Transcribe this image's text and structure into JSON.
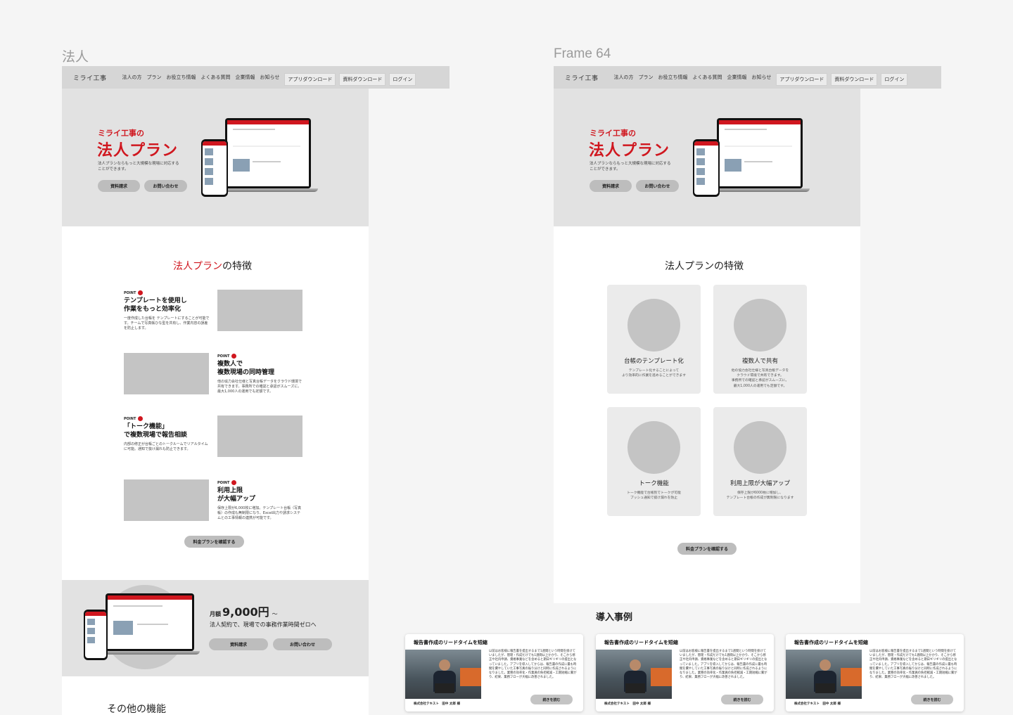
{
  "frames": [
    {
      "label": "法人"
    },
    {
      "label": "Frame 64"
    }
  ],
  "nav": {
    "brand": "ミライ工事",
    "items": [
      "法人の方",
      "プラン",
      "お役立ち情報",
      "よくある質問",
      "企業情報",
      "お知らせ"
    ],
    "buttons": [
      "アプリダウンロード",
      "資料ダウンロード",
      "ログイン"
    ]
  },
  "hero": {
    "subtitle": "ミライ工事の",
    "title": "法人プラン",
    "desc": "法人プランならもっと大規模な現場に対応することができます。",
    "btn_docs": "資料請求",
    "btn_contact": "お問い合わせ"
  },
  "features": {
    "title_red": "法人プラン",
    "title_rest": "の特徴",
    "title_full": "法人プランの特徴",
    "point_label": "POINT",
    "points": [
      {
        "title": "テンプレートを使用し\n作業をもっと効率化",
        "desc": "一度作成した台帳を テンプレートにすることが可能です。チームで写真帳ひな型を共有し、作業内容の誤差を防止します。"
      },
      {
        "title": "複数人で\n複数現場の同時管理",
        "desc": "他の協力会社仕様と写真台帳データをクラウド環境で共有できます。事務所での確認と承認がスムーズに。最大1,000人の運用でも定額です。"
      },
      {
        "title": "「トーク機能」\nで複数現場で報告相談",
        "desc": "内部の修正が台帳ごとのトークルームでリアルタイムに可能。通知で抜け漏れも防止できます。"
      },
      {
        "title": "利用上限\nが大幅アップ",
        "desc": "保存上限が6,000枚に増加。テンプレート台帳（写真帳）の作成も無制限になり、Excel出力や請求システムとの工事情報の連携が可能です。"
      }
    ],
    "cta": "料金プランを確認する"
  },
  "price": {
    "prefix": "月額",
    "amount": "9,000円",
    "suffix": "～",
    "desc": "法人契約で、現場での事務作業時間ゼロへ",
    "btn_docs": "資料請求",
    "btn_contact": "お問い合わせ"
  },
  "other": {
    "title": "その他の機能"
  },
  "cards": [
    {
      "title": "台帳のテンプレート化",
      "desc": "テンプレート化することによって\nより効率的に作業を進めることができます"
    },
    {
      "title": "複数人で共有",
      "desc": "他の協力会社仕様と写真台帳データを\nクラウド環境で共有できます。\n事務所での確認と承認がスムーズに。\n最大1,000人の運用でも定額です。"
    },
    {
      "title": "トーク機能",
      "desc": "トーク機能で台帳別でトークが可能\nプッシュ通知で抜け漏れを防止"
    },
    {
      "title": "利用上限が大幅アップ",
      "desc": "保存上限が6000枚に増加し、\nテンプレート台帳の作成が無制限になります"
    }
  ],
  "cases": {
    "title": "導入事例",
    "items": [
      {
        "title": "報告書作成のリードタイムを短縮",
        "text": "以前はお客様に報告書を提出するまで1週間という時間を掛けていましたが、管理・作成だけでも1週間以上かかり、そこから修正や社内申請、資格事業などを含めると期日ギリギリの提出となっていました。アプリを導入してからは、報告書の作成に最も時間を費やしていた工事写真の振り分けと同時に作成されるようになりました。業務の効率化・作業員の負担軽減・工期短縮に繋がり、結果、業務フローが大幅に改善されました。",
        "company": "株式会社テキスト　田中 太郎 様",
        "more": "続きを読む"
      },
      {
        "title": "報告書作成のリードタイムを短縮",
        "text": "以前はお客様に報告書を提出するまで1週間という時間を掛けていましたが、管理・作成だけでも1週間以上かかり、そこから修正や社内申請、資格事業などを含めると期日ギリギリの提出となっていました。アプリを導入してからは、報告書の作成に最も時間を費やしていた工事写真の振り分けと同時に作成されるようになりました。業務の効率化・作業員の負担軽減・工期短縮に繋がり、結果、業務フローが大幅に改善されました。",
        "company": "株式会社テキスト　田中 太郎 様",
        "more": "続きを読む"
      },
      {
        "title": "報告書作成のリードタイムを短縮",
        "text": "以前はお客様に報告書を提出するまで1週間という時間を掛けていましたが、管理・作成だけでも1週間以上かかり、そこから修正や社内申請、資格事業などを含めると期日ギリギリの提出となっていました。アプリを導入してからは、報告書の作成に最も時間を費やしていた工事写真の振り分けと同時に作成されるようになりました。業務の効率化・作業員の負担軽減・工期短縮に繋がり、結果、業務フローが大幅に改善されました。",
        "company": "株式会社テキスト　田中 太郎 様",
        "more": "続きを読む"
      }
    ]
  },
  "colors": {
    "accent": "#d0171f",
    "hero_bg": "#e2e2e2",
    "nav_bg": "#d6d6d6",
    "placeholder": "#c4c4c4"
  }
}
